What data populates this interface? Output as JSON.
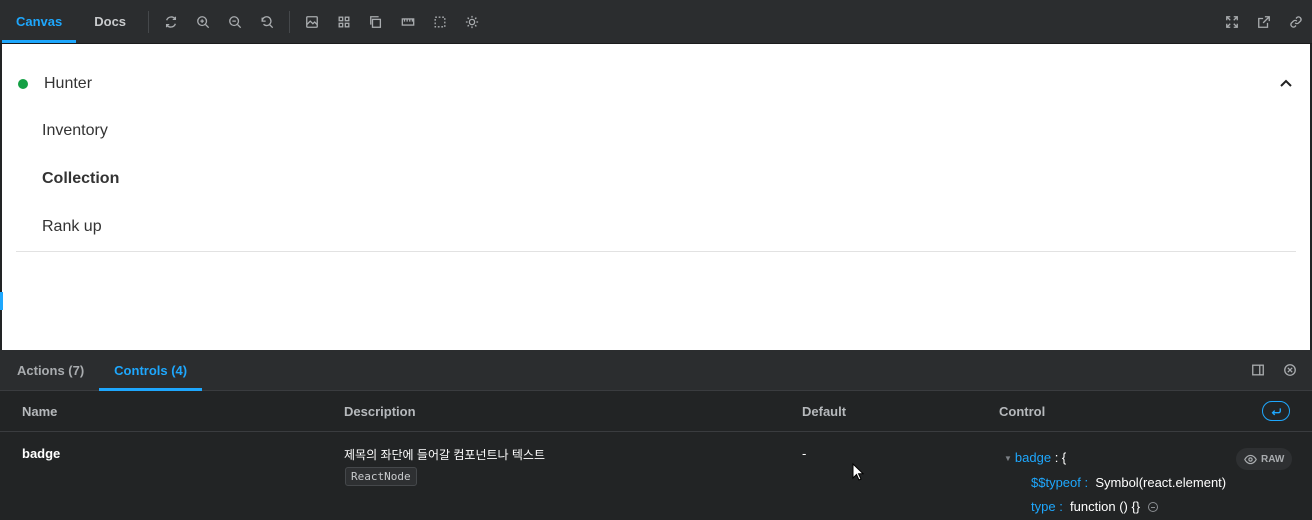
{
  "toolbar": {
    "tabs": [
      "Canvas",
      "Docs"
    ],
    "icons": [
      "refresh-icon",
      "zoom-in-icon",
      "zoom-out-icon",
      "zoom-reset-icon",
      "background-icon",
      "grid-icon",
      "viewport-icon",
      "measure-icon",
      "outline-icon",
      "theme-icon"
    ],
    "right_icons": [
      "fullscreen-icon",
      "open-new-tab-icon",
      "copy-link-icon"
    ]
  },
  "canvas": {
    "header_label": "Hunter",
    "status_color": "#14a044",
    "items": [
      "Inventory",
      "Collection",
      "Rank up"
    ]
  },
  "panel": {
    "tabs": [
      "Actions (7)",
      "Controls (4)"
    ],
    "columns": [
      "Name",
      "Description",
      "Default",
      "Control"
    ],
    "rows": [
      {
        "name": "badge",
        "description": "제목의 좌단에 들어갈 컴포넌트나 텍스트",
        "type": "ReactNode",
        "default": "-",
        "control": {
          "root_key": "badge",
          "root_open": " : {",
          "lines": [
            {
              "key": "$$typeof",
              "value": "Symbol(react.element)"
            },
            {
              "key": "type",
              "value": "function () {}"
            }
          ],
          "raw_label": "RAW"
        }
      }
    ]
  },
  "colors": {
    "accent": "#1ea7fd",
    "status_green": "#14a044"
  }
}
